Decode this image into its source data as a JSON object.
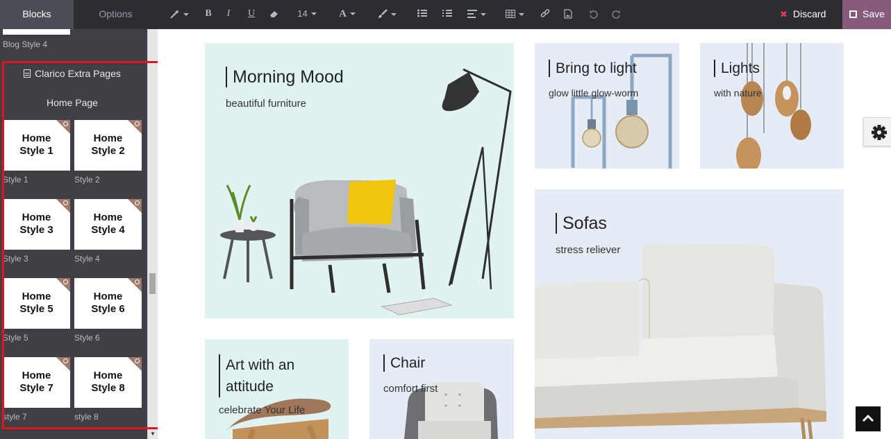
{
  "sidebar": {
    "tabs": [
      {
        "label": "Blocks",
        "active": true
      },
      {
        "label": "Options",
        "active": false
      }
    ],
    "prev_snippet_caption": "Blog Style 4",
    "category_title": "Clarico Extra Pages",
    "category_subtitle": "Home Page",
    "snippets": [
      {
        "label_line1": "Home",
        "label_line2": "Style 1",
        "caption": "Style 1"
      },
      {
        "label_line1": "Home",
        "label_line2": "Style 2",
        "caption": "Style 2"
      },
      {
        "label_line1": "Home",
        "label_line2": "Style 3",
        "caption": "Style 3"
      },
      {
        "label_line1": "Home",
        "label_line2": "Style 4",
        "caption": "Style 4"
      },
      {
        "label_line1": "Home",
        "label_line2": "Style 5",
        "caption": "Style 5"
      },
      {
        "label_line1": "Home",
        "label_line2": "Style 6",
        "caption": "Style 6"
      },
      {
        "label_line1": "Home",
        "label_line2": "Style 7",
        "caption": "style 7"
      },
      {
        "label_line1": "Home",
        "label_line2": "Style 8",
        "caption": "style 8"
      }
    ],
    "highlight_color": "#e0141a"
  },
  "toolbar": {
    "font_size": "14",
    "discard_label": "Discard",
    "save_label": "Save",
    "save_color": "#875a7b",
    "discard_icon_color": "#e03a4f"
  },
  "page": {
    "cards": {
      "morning": {
        "title": "Morning Mood",
        "subtitle": "beautiful furniture"
      },
      "bring": {
        "title": "Bring to light",
        "subtitle": "glow little glow-worm"
      },
      "lights": {
        "title": "Lights",
        "subtitle": "with nature"
      },
      "sofas": {
        "title": "Sofas",
        "subtitle": "stress reliever"
      },
      "art": {
        "title_line1": "Art with an",
        "title_line2": "attitude",
        "subtitle": "celebrate Your Life"
      },
      "chair": {
        "title": "Chair",
        "subtitle": "comfort first"
      }
    }
  }
}
